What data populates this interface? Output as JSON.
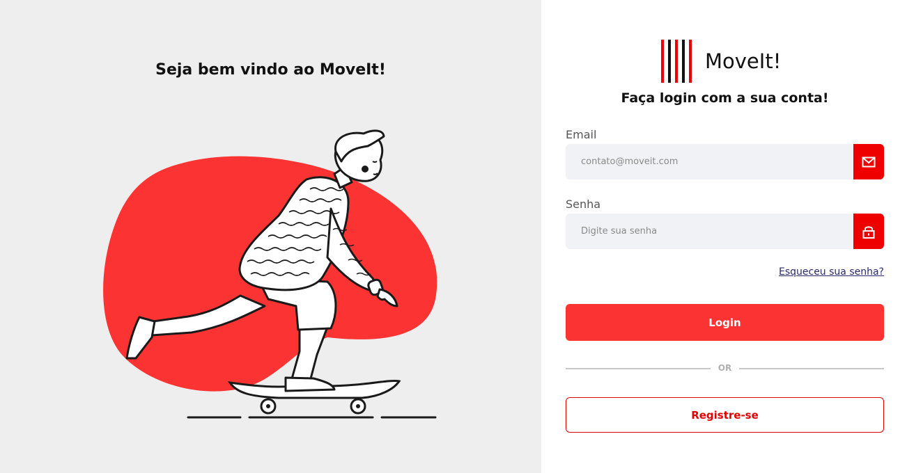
{
  "welcome": {
    "title": "Seja bem vindo ao MoveIt!"
  },
  "brand": {
    "name": "MoveIt!",
    "primary_color": "#fc3333",
    "icon_color": "#ee0000"
  },
  "login": {
    "heading": "Faça login com a sua conta!",
    "email": {
      "label": "Email",
      "placeholder": "contato@moveit.com",
      "icon": "mail-icon"
    },
    "password": {
      "label": "Senha",
      "placeholder": "Digite sua senha",
      "icon": "lock-icon"
    },
    "forgot_link": "Esqueceu sua senha?",
    "submit_label": "Login",
    "divider_text": "OR",
    "register_label": "Registre-se"
  }
}
